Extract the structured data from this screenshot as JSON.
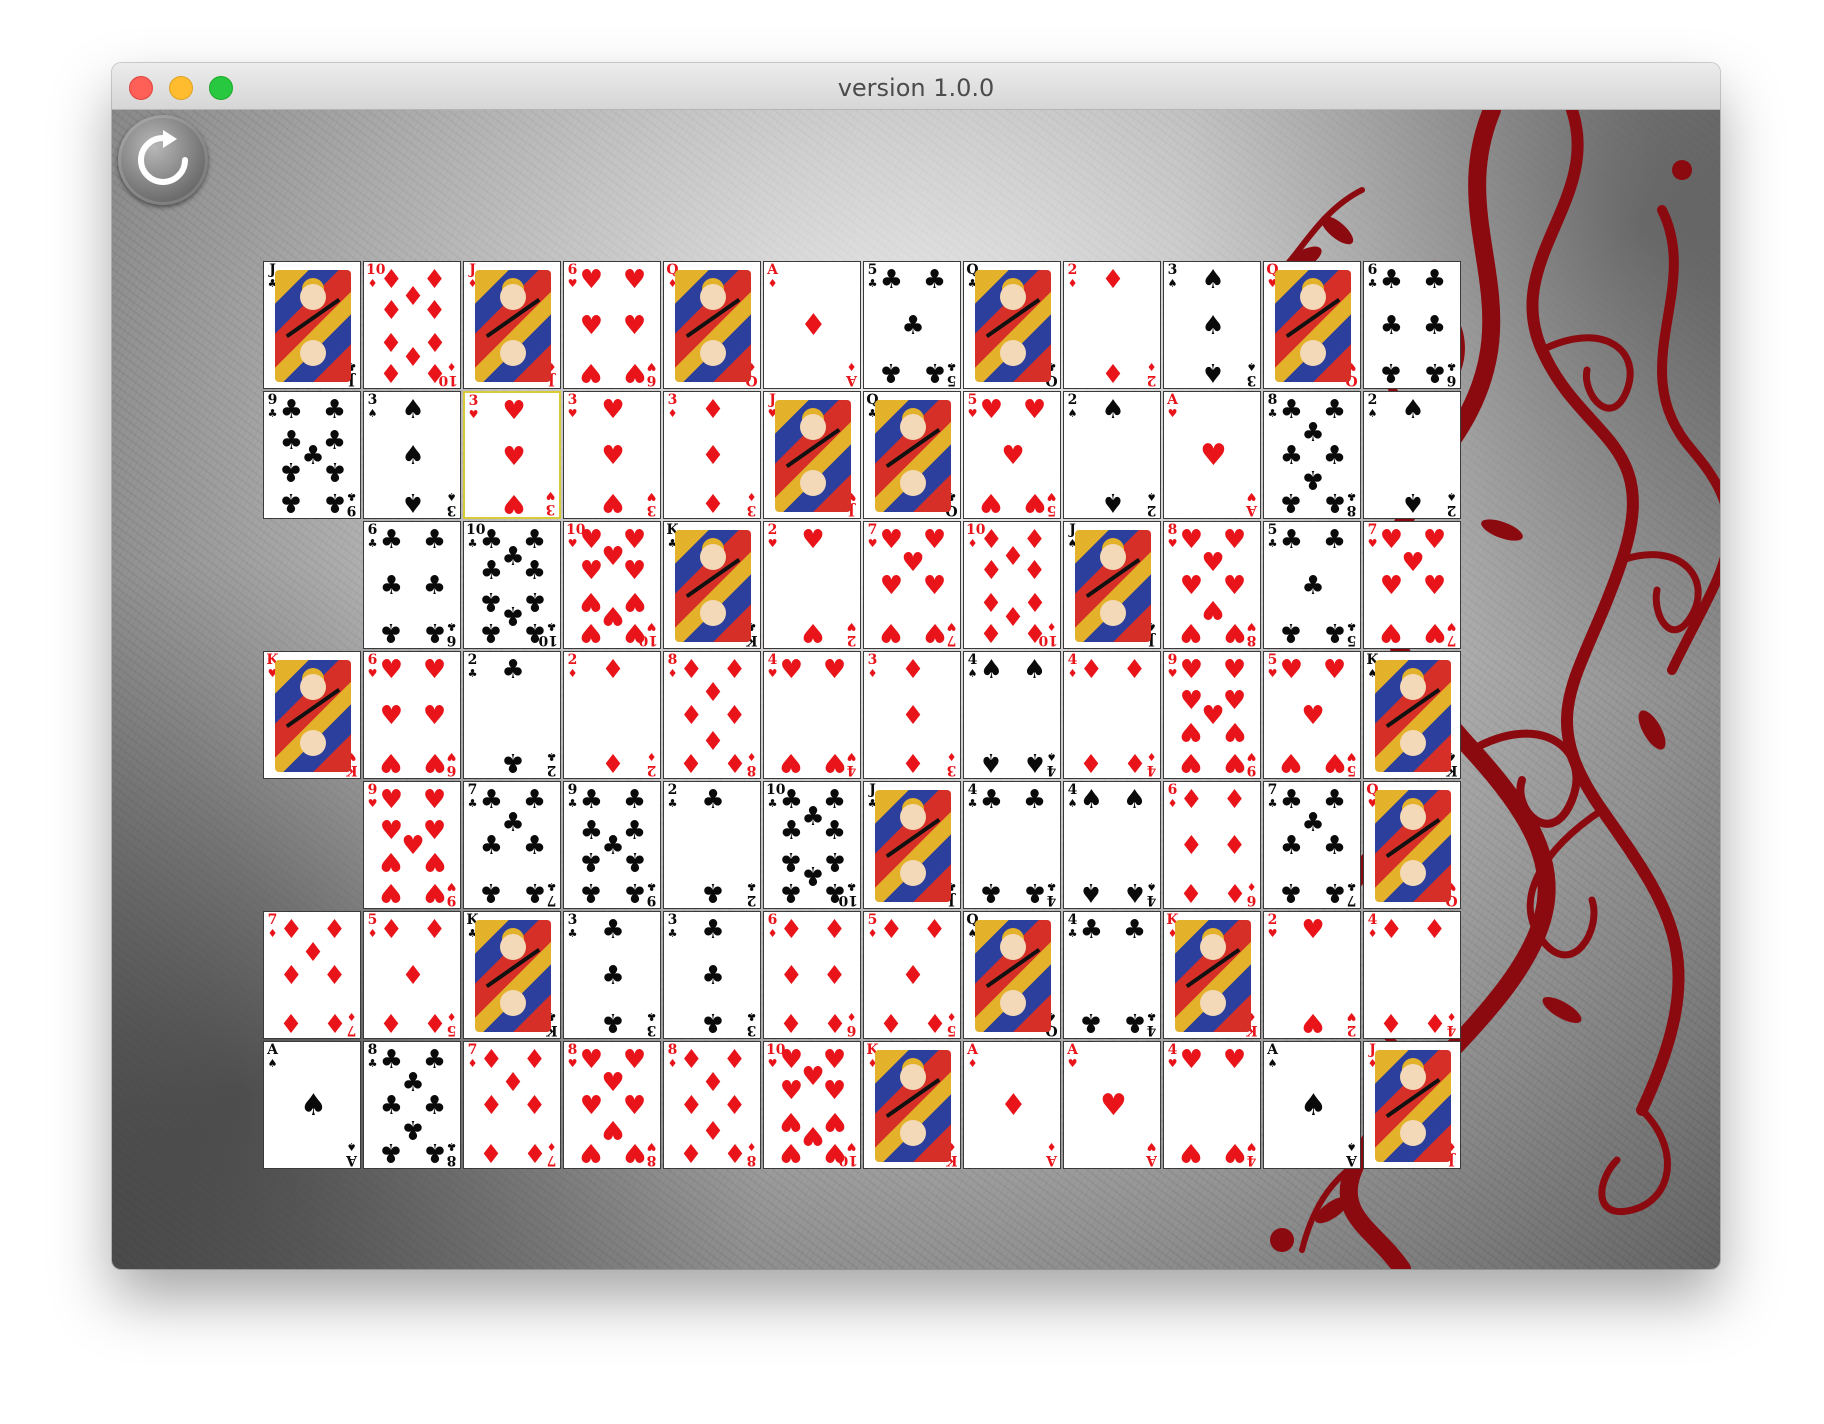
{
  "window": {
    "title": "version 1.0.0"
  },
  "toolbar": {
    "restart_icon": "restart-icon"
  },
  "board": {
    "cells": [
      {
        "r": 0,
        "c": 0,
        "rank": "J",
        "suit": "clubs"
      },
      {
        "r": 0,
        "c": 1,
        "rank": "10",
        "suit": "diamonds"
      },
      {
        "r": 0,
        "c": 2,
        "rank": "J",
        "suit": "diamonds"
      },
      {
        "r": 0,
        "c": 3,
        "rank": "6",
        "suit": "hearts"
      },
      {
        "r": 0,
        "c": 4,
        "rank": "Q",
        "suit": "diamonds"
      },
      {
        "r": 0,
        "c": 5,
        "rank": "A",
        "suit": "diamonds"
      },
      {
        "r": 0,
        "c": 6,
        "rank": "5",
        "suit": "clubs"
      },
      {
        "r": 0,
        "c": 7,
        "rank": "Q",
        "suit": "clubs"
      },
      {
        "r": 0,
        "c": 8,
        "rank": "2",
        "suit": "diamonds"
      },
      {
        "r": 0,
        "c": 9,
        "rank": "3",
        "suit": "spades"
      },
      {
        "r": 0,
        "c": 10,
        "rank": "Q",
        "suit": "hearts"
      },
      {
        "r": 0,
        "c": 11,
        "rank": "6",
        "suit": "clubs"
      },
      {
        "r": 1,
        "c": 0,
        "rank": "9",
        "suit": "clubs"
      },
      {
        "r": 1,
        "c": 1,
        "rank": "3",
        "suit": "spades"
      },
      {
        "r": 1,
        "c": 2,
        "rank": "3",
        "suit": "hearts",
        "selected": true
      },
      {
        "r": 1,
        "c": 3,
        "rank": "3",
        "suit": "hearts"
      },
      {
        "r": 1,
        "c": 4,
        "rank": "3",
        "suit": "diamonds"
      },
      {
        "r": 1,
        "c": 5,
        "rank": "J",
        "suit": "hearts"
      },
      {
        "r": 1,
        "c": 6,
        "rank": "Q",
        "suit": "clubs"
      },
      {
        "r": 1,
        "c": 7,
        "rank": "5",
        "suit": "hearts"
      },
      {
        "r": 1,
        "c": 8,
        "rank": "2",
        "suit": "spades"
      },
      {
        "r": 1,
        "c": 9,
        "rank": "A",
        "suit": "hearts"
      },
      {
        "r": 1,
        "c": 10,
        "rank": "8",
        "suit": "clubs"
      },
      {
        "r": 1,
        "c": 11,
        "rank": "2",
        "suit": "spades"
      },
      {
        "r": 2,
        "c": 1,
        "rank": "6",
        "suit": "clubs"
      },
      {
        "r": 2,
        "c": 2,
        "rank": "10",
        "suit": "clubs"
      },
      {
        "r": 2,
        "c": 3,
        "rank": "10",
        "suit": "hearts"
      },
      {
        "r": 2,
        "c": 4,
        "rank": "K",
        "suit": "clubs"
      },
      {
        "r": 2,
        "c": 5,
        "rank": "2",
        "suit": "hearts"
      },
      {
        "r": 2,
        "c": 6,
        "rank": "7",
        "suit": "hearts"
      },
      {
        "r": 2,
        "c": 7,
        "rank": "10",
        "suit": "diamonds"
      },
      {
        "r": 2,
        "c": 8,
        "rank": "J",
        "suit": "spades"
      },
      {
        "r": 2,
        "c": 9,
        "rank": "8",
        "suit": "hearts"
      },
      {
        "r": 2,
        "c": 10,
        "rank": "5",
        "suit": "clubs"
      },
      {
        "r": 2,
        "c": 11,
        "rank": "7",
        "suit": "hearts"
      },
      {
        "r": 3,
        "c": 0,
        "rank": "K",
        "suit": "hearts"
      },
      {
        "r": 3,
        "c": 1,
        "rank": "6",
        "suit": "hearts"
      },
      {
        "r": 3,
        "c": 2,
        "rank": "2",
        "suit": "clubs"
      },
      {
        "r": 3,
        "c": 3,
        "rank": "2",
        "suit": "diamonds"
      },
      {
        "r": 3,
        "c": 4,
        "rank": "8",
        "suit": "diamonds"
      },
      {
        "r": 3,
        "c": 5,
        "rank": "4",
        "suit": "hearts"
      },
      {
        "r": 3,
        "c": 6,
        "rank": "3",
        "suit": "diamonds"
      },
      {
        "r": 3,
        "c": 7,
        "rank": "4",
        "suit": "spades"
      },
      {
        "r": 3,
        "c": 8,
        "rank": "4",
        "suit": "diamonds"
      },
      {
        "r": 3,
        "c": 9,
        "rank": "9",
        "suit": "hearts"
      },
      {
        "r": 3,
        "c": 10,
        "rank": "5",
        "suit": "hearts"
      },
      {
        "r": 3,
        "c": 11,
        "rank": "K",
        "suit": "spades"
      },
      {
        "r": 4,
        "c": 1,
        "rank": "9",
        "suit": "hearts"
      },
      {
        "r": 4,
        "c": 2,
        "rank": "7",
        "suit": "clubs"
      },
      {
        "r": 4,
        "c": 3,
        "rank": "9",
        "suit": "clubs"
      },
      {
        "r": 4,
        "c": 4,
        "rank": "2",
        "suit": "clubs"
      },
      {
        "r": 4,
        "c": 5,
        "rank": "10",
        "suit": "clubs"
      },
      {
        "r": 4,
        "c": 6,
        "rank": "J",
        "suit": "clubs"
      },
      {
        "r": 4,
        "c": 7,
        "rank": "4",
        "suit": "clubs"
      },
      {
        "r": 4,
        "c": 8,
        "rank": "4",
        "suit": "spades"
      },
      {
        "r": 4,
        "c": 9,
        "rank": "6",
        "suit": "diamonds"
      },
      {
        "r": 4,
        "c": 10,
        "rank": "7",
        "suit": "clubs"
      },
      {
        "r": 4,
        "c": 11,
        "rank": "Q",
        "suit": "hearts"
      },
      {
        "r": 5,
        "c": 0,
        "rank": "7",
        "suit": "diamonds"
      },
      {
        "r": 5,
        "c": 1,
        "rank": "5",
        "suit": "diamonds"
      },
      {
        "r": 5,
        "c": 2,
        "rank": "K",
        "suit": "clubs"
      },
      {
        "r": 5,
        "c": 3,
        "rank": "3",
        "suit": "clubs"
      },
      {
        "r": 5,
        "c": 4,
        "rank": "3",
        "suit": "clubs"
      },
      {
        "r": 5,
        "c": 5,
        "rank": "6",
        "suit": "diamonds"
      },
      {
        "r": 5,
        "c": 6,
        "rank": "5",
        "suit": "diamonds"
      },
      {
        "r": 5,
        "c": 7,
        "rank": "Q",
        "suit": "spades"
      },
      {
        "r": 5,
        "c": 8,
        "rank": "4",
        "suit": "clubs"
      },
      {
        "r": 5,
        "c": 9,
        "rank": "K",
        "suit": "diamonds"
      },
      {
        "r": 5,
        "c": 10,
        "rank": "2",
        "suit": "hearts"
      },
      {
        "r": 5,
        "c": 11,
        "rank": "4",
        "suit": "diamonds"
      },
      {
        "r": 6,
        "c": 0,
        "rank": "A",
        "suit": "spades"
      },
      {
        "r": 6,
        "c": 1,
        "rank": "8",
        "suit": "clubs"
      },
      {
        "r": 6,
        "c": 2,
        "rank": "7",
        "suit": "diamonds"
      },
      {
        "r": 6,
        "c": 3,
        "rank": "8",
        "suit": "hearts"
      },
      {
        "r": 6,
        "c": 4,
        "rank": "8",
        "suit": "diamonds"
      },
      {
        "r": 6,
        "c": 5,
        "rank": "10",
        "suit": "hearts"
      },
      {
        "r": 6,
        "c": 6,
        "rank": "K",
        "suit": "diamonds"
      },
      {
        "r": 6,
        "c": 7,
        "rank": "A",
        "suit": "diamonds"
      },
      {
        "r": 6,
        "c": 8,
        "rank": "A",
        "suit": "hearts"
      },
      {
        "r": 6,
        "c": 9,
        "rank": "4",
        "suit": "hearts"
      },
      {
        "r": 6,
        "c": 10,
        "rank": "A",
        "suit": "spades"
      },
      {
        "r": 6,
        "c": 11,
        "rank": "J",
        "suit": "diamonds"
      }
    ]
  },
  "colors": {
    "red_suit": "#e8141a",
    "black_suit": "#0a0a0a",
    "vine": "#8b0a10",
    "selected_border": "#d9cb35"
  }
}
